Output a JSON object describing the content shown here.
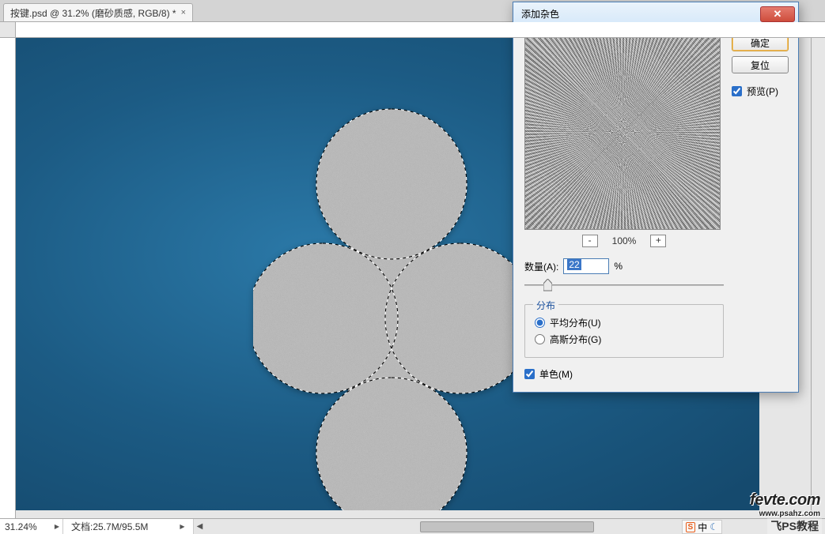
{
  "tab": {
    "label": "按键.psd @ 31.2% (磨砂质感, RGB/8) *"
  },
  "status": {
    "zoom": "31.24%",
    "doc": "文档:25.7M/95.5M"
  },
  "dialog": {
    "title": "添加杂色",
    "ok": "确定",
    "reset": "复位",
    "preview_label": "预览(P)",
    "preview_checked": true,
    "zoom_label": "100%",
    "amount_label": "数量(A):",
    "amount_value": "22",
    "amount_unit": "%",
    "group_title": "分布",
    "radio_uniform": "平均分布(U)",
    "radio_gauss": "高斯分布(G)",
    "mono_label": "单色(M)",
    "mono_checked": true,
    "distribution": "uniform"
  },
  "watermark": {
    "site": "fevte.com",
    "sub": "www.psahz.com",
    "overlay": "飞PS教程"
  },
  "ime": {
    "badge": "S",
    "text": "中"
  }
}
